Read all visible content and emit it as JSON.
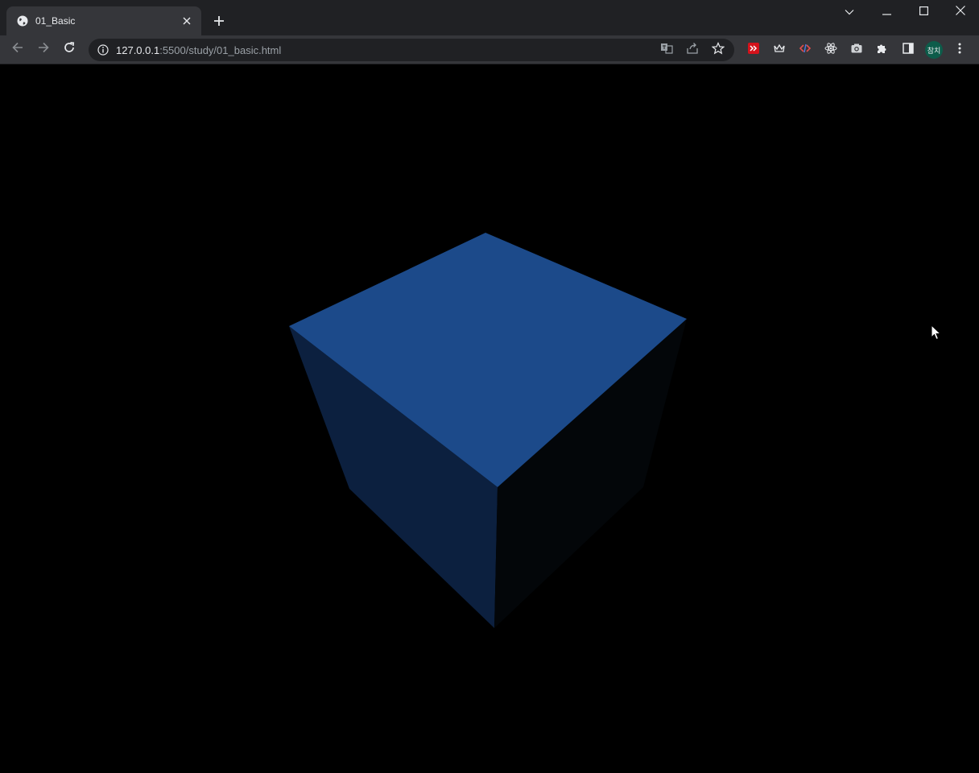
{
  "browser": {
    "tab": {
      "title": "01_Basic",
      "favicon": "globe-icon"
    },
    "new_tab_icon": "plus-icon",
    "window_controls": [
      "chevron-down-icon",
      "minimize-icon",
      "maximize-icon",
      "close-icon"
    ],
    "toolbar": {
      "back_icon": "arrow-left-icon",
      "forward_icon": "arrow-right-icon",
      "reload_icon": "reload-icon"
    },
    "address_bar": {
      "host": "127.0.0.1",
      "rest": ":5500/study/01_basic.html",
      "site_info_icon": "info-icon",
      "actions": [
        "translate-icon",
        "share-icon",
        "star-icon"
      ]
    },
    "extensions": [
      "red-extension-icon",
      "crown-extension-icon",
      "code-extension-icon",
      "react-extension-icon",
      "camera-extension-icon",
      "puzzle-icon",
      "side-panel-icon"
    ],
    "profile": {
      "label": "참치"
    },
    "menu_icon": "kebab-menu-icon"
  },
  "scene": {
    "background": "#000000",
    "cube_top_color": "#1c4a8a",
    "cube_left_color": "#0c203f",
    "cube_right_color": "#030609"
  },
  "colors": {
    "tabstrip": "#202124",
    "toolbar": "#35363a",
    "text": "#e8eaed",
    "muted": "#9aa0a6"
  }
}
